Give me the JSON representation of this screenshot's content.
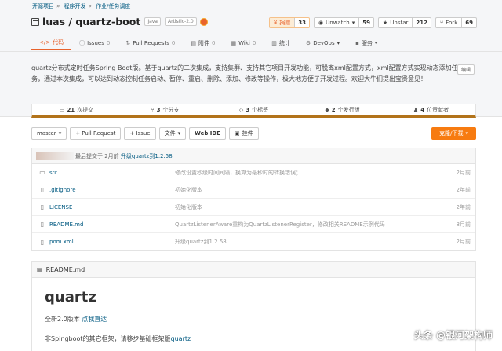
{
  "breadcrumb": [
    "开源项目",
    "程序开发",
    "作业/任务调度"
  ],
  "repo": {
    "title": "luas / quartz-boot",
    "lang_tag": "Java",
    "license_tag": "Artistic-2.0"
  },
  "actions": [
    {
      "label": "捐赠",
      "count": "33",
      "icon": "donate-icon"
    },
    {
      "label": "Unwatch",
      "count": "59",
      "icon": "eye-icon"
    },
    {
      "label": "Unstar",
      "count": "212",
      "icon": "star-icon"
    },
    {
      "label": "Fork",
      "count": "69",
      "icon": "fork-icon"
    }
  ],
  "tabs": [
    {
      "label": "代码",
      "count": "",
      "icon": "</>"
    },
    {
      "label": "Issues",
      "count": "0",
      "icon": "ⓘ"
    },
    {
      "label": "Pull Requests",
      "count": "0",
      "icon": "⇅"
    },
    {
      "label": "附件",
      "count": "0",
      "icon": "▤"
    },
    {
      "label": "Wiki",
      "count": "0",
      "icon": "▦"
    },
    {
      "label": "统计",
      "count": "",
      "icon": "▥"
    },
    {
      "label": "DevOps",
      "count": "",
      "icon": "⚙"
    },
    {
      "label": "服务",
      "count": "",
      "icon": "▪"
    }
  ],
  "description": "quartz分布式定时任务Spring Boot版。基于quartz的二次集成，支持集群、支持其它项目开发功能，可脱离xml配置方式，xml配置方式实现动态添加任务，通过本次集成，可以达到动态控制任务启动、暂停、重启、删除、添加、修改等操作，极大地方便了开发过程。欢迎大牛们提出宝贵意见！",
  "edit_label": "编辑",
  "stats": [
    {
      "num": "21",
      "label": "次提交"
    },
    {
      "num": "3",
      "label": "个分支"
    },
    {
      "num": "3",
      "label": "个标签"
    },
    {
      "num": "2",
      "label": "个发行版"
    },
    {
      "num": "4",
      "label": "位贡献者"
    }
  ],
  "toolbar": {
    "branch": "master",
    "pull_request": "+ Pull Request",
    "issue": "+ Issue",
    "file": "文件",
    "webide": "Web IDE",
    "mount": "挂件",
    "clone": "克隆/下载"
  },
  "last_commit": {
    "text": "最后提交于 2月前",
    "message": "升级quartz到1.2.58"
  },
  "files": [
    {
      "icon": "folder-icon",
      "name": "src",
      "message": "修改设置秒级时间间隔，换算为毫秒时的转换错误；",
      "time": "2月前"
    },
    {
      "icon": "file-icon",
      "name": ".gitignore",
      "message": "初始化版本",
      "time": "2年前"
    },
    {
      "icon": "file-icon",
      "name": "LICENSE",
      "message": "初始化版本",
      "time": "2年前"
    },
    {
      "icon": "file-icon",
      "name": "README.md",
      "message": "QuartzListenerAware重构为QuartzListenerRegister，修改相关README示例代码",
      "time": "8月前"
    },
    {
      "icon": "file-icon",
      "name": "pom.xml",
      "message": "升级quartz到1.2.58",
      "time": "2月前"
    }
  ],
  "readme": {
    "header": "README.md",
    "title": "quartz",
    "line1_text": "全新2.0版本 ",
    "line1_link": "点我直达",
    "line2_text": "非Spingboot的其它框架，请移步基础框架版",
    "line2_link": "quartz"
  },
  "watermark": "头条 @银河架构师"
}
